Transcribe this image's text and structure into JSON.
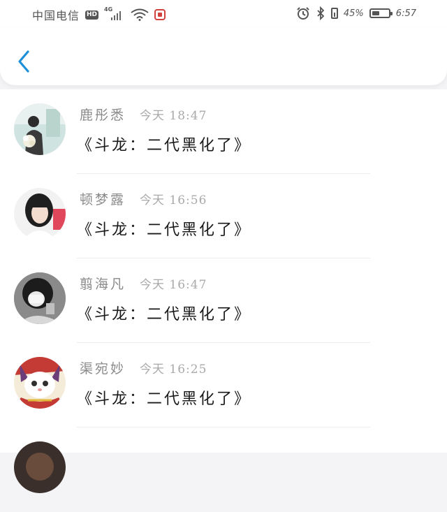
{
  "status_bar": {
    "carrier": "中国电信",
    "hd_badge": "HD",
    "network": "4G",
    "battery_percent": "45%",
    "battery_level": 0.45,
    "time": "6:57",
    "icons": [
      "signal-bars-icon",
      "wifi-icon",
      "app-notification-icon",
      "alarm-icon",
      "bluetooth-icon",
      "vibrate-icon",
      "battery-icon"
    ]
  },
  "nav": {
    "back_icon": "chevron-left-icon",
    "accent": "#1e90d8"
  },
  "comments": [
    {
      "name": "鹿彤悉",
      "time": "今天 18:47",
      "message": "《斗龙：二代黑化了》",
      "avatar": "avatar-photo-woman-flowers"
    },
    {
      "name": "顿梦露",
      "time": "今天 16:56",
      "message": "《斗龙：二代黑化了》",
      "avatar": "avatar-photo-girl-portrait"
    },
    {
      "name": "翦海凡",
      "time": "今天 16:47",
      "message": "《斗龙：二代黑化了》",
      "avatar": "avatar-photo-girl-masked"
    },
    {
      "name": "渠宛妙",
      "time": "今天 16:25",
      "message": "《斗龙：二代黑化了》",
      "avatar": "avatar-photo-cat-scarf"
    }
  ]
}
